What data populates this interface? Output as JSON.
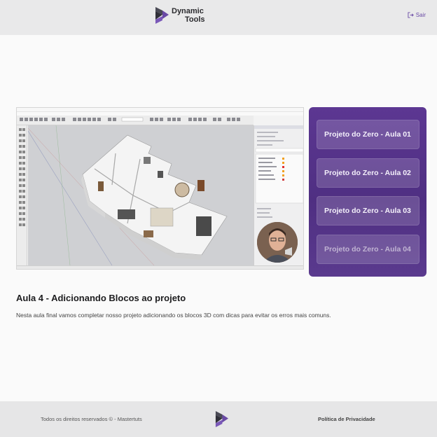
{
  "header": {
    "logo_line1": "Dynamic",
    "logo_line2": "Tools",
    "logout_label": "Sair"
  },
  "lesson_list": [
    {
      "label": "Projeto do Zero - Aula 01"
    },
    {
      "label": "Projeto do Zero - Aula 02"
    },
    {
      "label": "Projeto do Zero - Aula 03"
    },
    {
      "label": "Projeto do Zero - Aula 04"
    }
  ],
  "current_lesson": {
    "title": "Aula 4 - Adicionando Blocos ao projeto",
    "description": "Nesta aula final vamos completar nosso projeto adicionando os blocos 3D com dicas para evitar os erros mais comuns."
  },
  "footer": {
    "copyright": "Todos os direitos reservados © - Mastertuts",
    "privacy_label": "Política de Privacidade"
  },
  "colors": {
    "accent": "#5c3792",
    "header_bg": "#e9e9ea",
    "logo_dark": "#3a3a42",
    "logo_purple": "#6a4aa5"
  }
}
